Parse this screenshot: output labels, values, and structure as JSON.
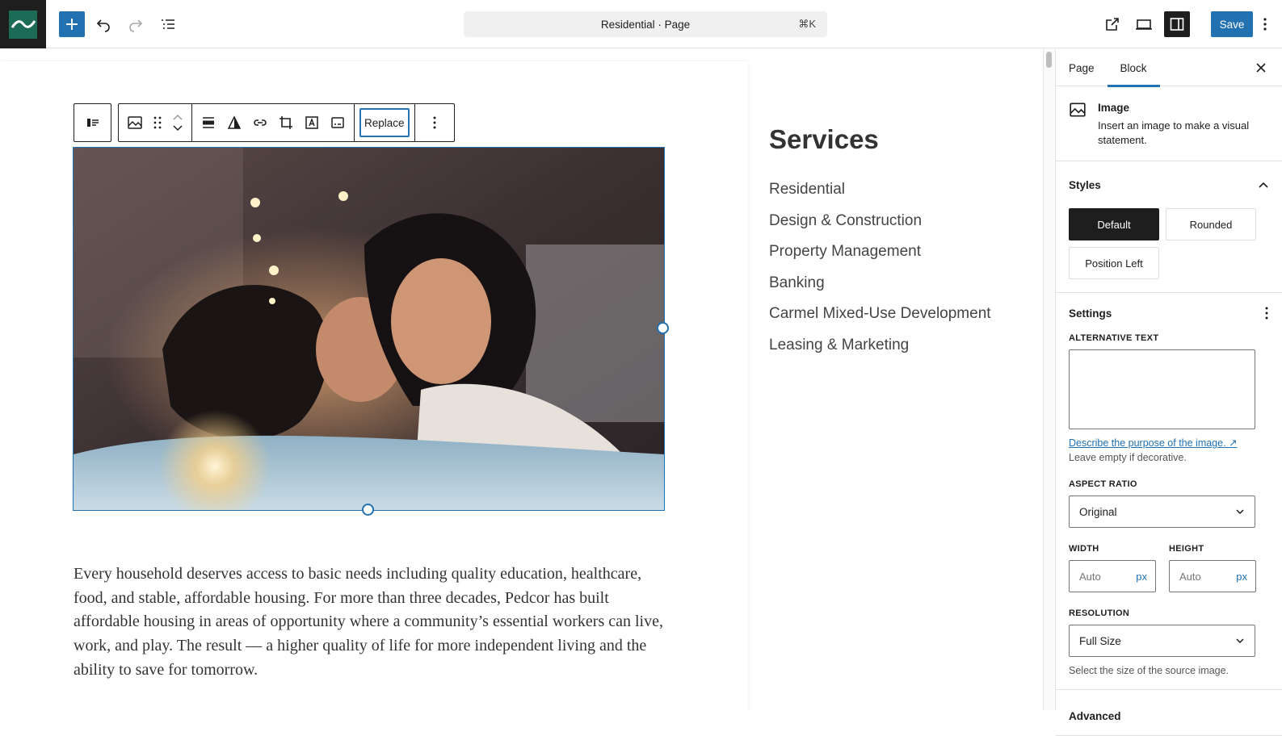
{
  "topbar": {
    "document_title": "Residential · Page",
    "shortcut": "⌘K",
    "save_label": "Save"
  },
  "block_toolbar": {
    "replace_label": "Replace"
  },
  "content": {
    "paragraph": "Every household deserves access to basic needs including quality education, healthcare, food, and stable, affordable housing. For more than three decades, Pedcor has built affordable housing in areas of opportunity where a community’s essential workers can live, work, and play. The result — a higher quality of life for more independent living and the ability to save for tomorrow.",
    "services_title": "Services",
    "services": [
      "Residential",
      "Design & Construction",
      "Property Management",
      "Banking",
      "Carmel Mixed-Use Development",
      "Leasing & Marketing"
    ]
  },
  "sidebar": {
    "tabs": [
      "Page",
      "Block"
    ],
    "active_tab": "Block",
    "block_title": "Image",
    "block_description": "Insert an image to make a visual statement.",
    "styles_title": "Styles",
    "styles": [
      "Default",
      "Rounded",
      "Position Left"
    ],
    "active_style": "Default",
    "settings_title": "Settings",
    "alt_label": "ALTERNATIVE TEXT",
    "alt_value": "",
    "alt_link": "Describe the purpose of the image.",
    "alt_help": "Leave empty if decorative.",
    "aspect_label": "ASPECT RATIO",
    "aspect_value": "Original",
    "width_label": "WIDTH",
    "height_label": "HEIGHT",
    "width_placeholder": "Auto",
    "height_placeholder": "Auto",
    "unit": "px",
    "resolution_label": "RESOLUTION",
    "resolution_value": "Full Size",
    "resolution_help": "Select the size of the source image.",
    "advanced_title": "Advanced"
  },
  "colors": {
    "accent": "#2271b1",
    "logo_bg": "#1e1e1e",
    "logo_tile": "#1c6b57"
  }
}
